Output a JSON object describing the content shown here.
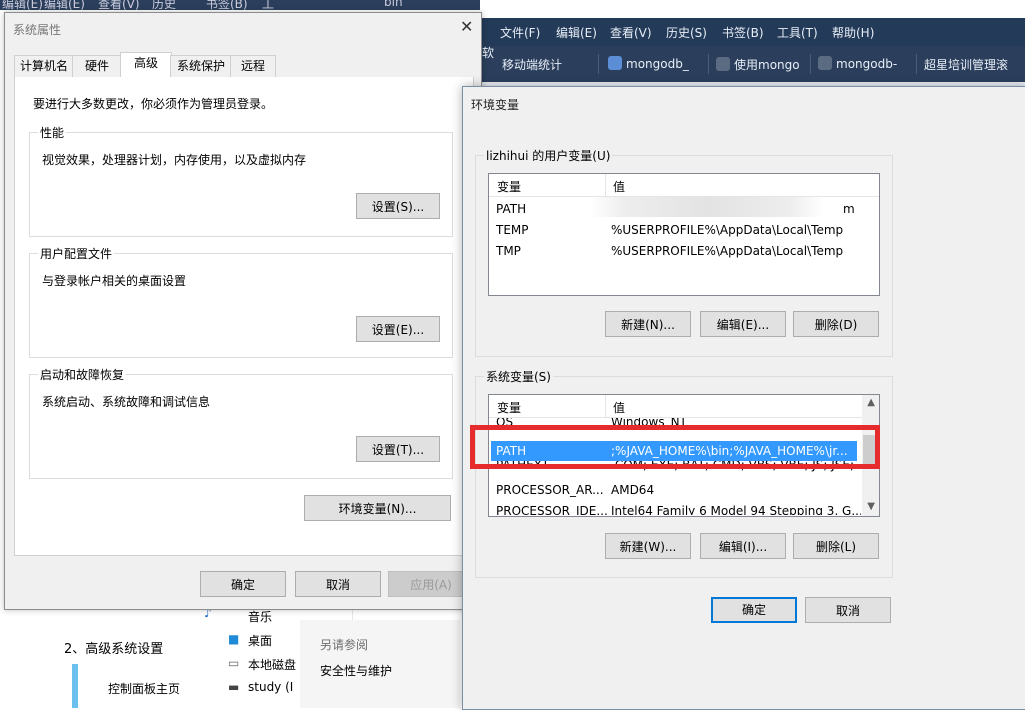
{
  "top_strip": {
    "items": [
      "编辑(E)",
      "查看(V)",
      "历史",
      "书签(B)",
      "工",
      "bin"
    ]
  },
  "browser": {
    "menu": [
      "文件(F)",
      "编辑(E)",
      "查看(V)",
      "历史(S)",
      "书签(B)",
      "工具(T)",
      "帮助(H)"
    ],
    "left_edge_text": "软",
    "bookmarks": [
      "移动端统计",
      "mongodb_",
      "使用mongo",
      "mongodb-",
      "超星培训管理滚"
    ]
  },
  "background": {
    "step_text": "2、高级系统设置",
    "nav_link": "控制面板主页",
    "explorer_items": [
      "音乐",
      "桌面",
      "本地磁盘",
      "study (I"
    ],
    "see_also_title": "另请参阅",
    "see_also_link": "安全性与维护"
  },
  "system_properties": {
    "title": "系统属性",
    "tabs": [
      "计算机名",
      "硬件",
      "高级",
      "系统保护",
      "远程"
    ],
    "active_tab": "高级",
    "admin_note": "要进行大多数更改，你必须作为管理员登录。",
    "performance": {
      "title": "性能",
      "desc": "视觉效果，处理器计划，内存使用，以及虚拟内存",
      "button": "设置(S)..."
    },
    "profile": {
      "title": "用户配置文件",
      "desc": "与登录帐户相关的桌面设置",
      "button": "设置(E)..."
    },
    "startup": {
      "title": "启动和故障恢复",
      "desc": "系统启动、系统故障和调试信息",
      "button": "设置(T)..."
    },
    "env_button": "环境变量(N)...",
    "ok": "确定",
    "cancel": "取消",
    "apply": "应用(A)"
  },
  "env_vars": {
    "title": "环境变量",
    "user_group_title": "lizhihui 的用户变量(U)",
    "col_var": "变量",
    "col_val": "值",
    "user_vars": [
      {
        "name": "PATH",
        "value": "m"
      },
      {
        "name": "TEMP",
        "value": "%USERPROFILE%\\AppData\\Local\\Temp"
      },
      {
        "name": "TMP",
        "value": "%USERPROFILE%\\AppData\\Local\\Temp"
      }
    ],
    "user_buttons": {
      "new": "新建(N)...",
      "edit": "编辑(E)...",
      "delete": "删除(D)"
    },
    "system_group_title": "系统变量(S)",
    "system_vars": [
      {
        "name": "OS",
        "value": "Windows_NT"
      },
      {
        "name": "PATH",
        "value": ";%JAVA_HOME%\\bin;%JAVA_HOME%\\jr..."
      },
      {
        "name": "PATHEXT",
        "value": ".COM;.EXE;.BAT;.CMD;.VBS;.VBE;.JS;.JSE;..."
      },
      {
        "name": "PROCESSOR_AR...",
        "value": "AMD64"
      },
      {
        "name": "PROCESSOR_IDE...",
        "value": "Intel64 Family 6 Model 94 Stepping 3, G..."
      }
    ],
    "selected_system_var": "PATH",
    "system_buttons": {
      "new": "新建(W)...",
      "edit": "编辑(I)...",
      "delete": "删除(L)"
    },
    "ok": "确定",
    "cancel": "取消"
  },
  "colors": {
    "selection": "#3399ff",
    "highlight_box": "#e52b2b",
    "browser_chrome": "#233a58"
  }
}
